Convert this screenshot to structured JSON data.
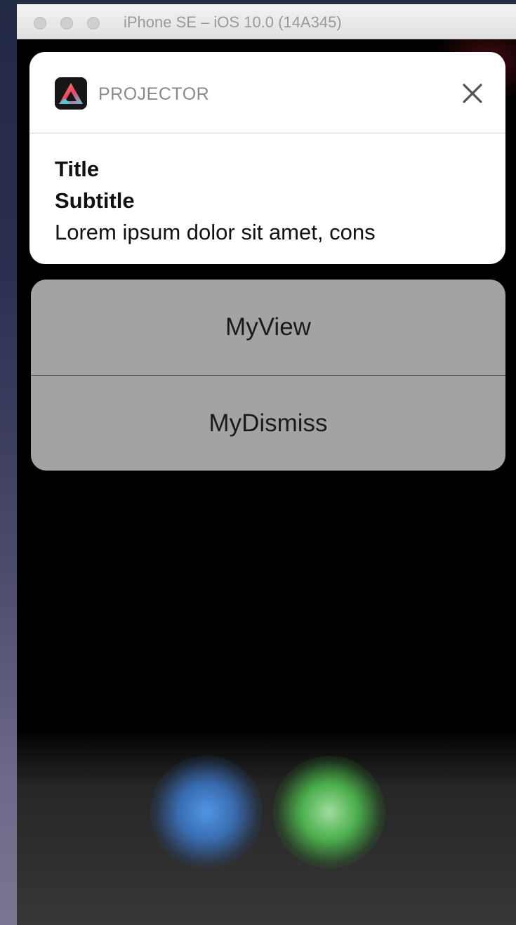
{
  "window": {
    "title": "iPhone SE – iOS 10.0 (14A345)"
  },
  "notification": {
    "app_name": "PROJECTOR",
    "title": "Title",
    "subtitle": "Subtitle",
    "message": "Lorem ipsum dolor sit amet, cons"
  },
  "actions": {
    "view_label": "MyView",
    "dismiss_label": "MyDismiss"
  },
  "icons": {
    "app": "projector-app-icon",
    "close": "close-icon"
  },
  "colors": {
    "notification_bg": "#ffffff",
    "actions_bg": "#a3a3a3",
    "screen_bg": "#000000"
  }
}
